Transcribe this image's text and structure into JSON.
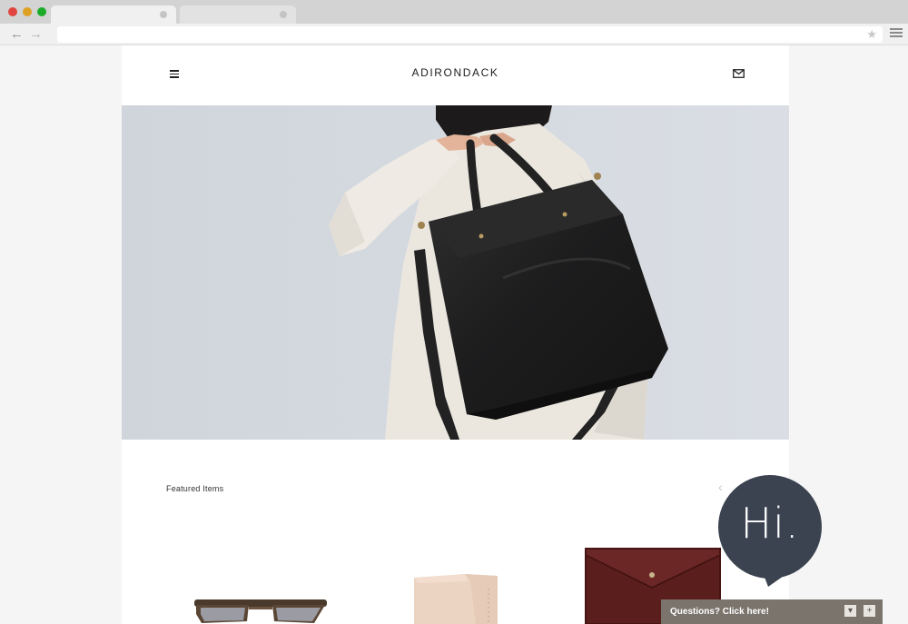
{
  "browser": {
    "back_glyph": "←",
    "forward_glyph": "→",
    "bookmark_glyph": "★",
    "traffic_colors": [
      "#e0443e",
      "#dea123",
      "#1aab29"
    ]
  },
  "site": {
    "brand": "ADIRONDACK",
    "menu_icon": "hamburger-icon",
    "contact_icon": "mail-icon"
  },
  "featured": {
    "title": "Featured Items",
    "prev_glyph": "‹"
  },
  "chat": {
    "greeting": "Hi.",
    "cta": "Questions? Click here!",
    "minimize_glyph": "▾",
    "expand_glyph": "+",
    "bar_color": "#7b746c",
    "bubble_color": "#3b4350"
  }
}
